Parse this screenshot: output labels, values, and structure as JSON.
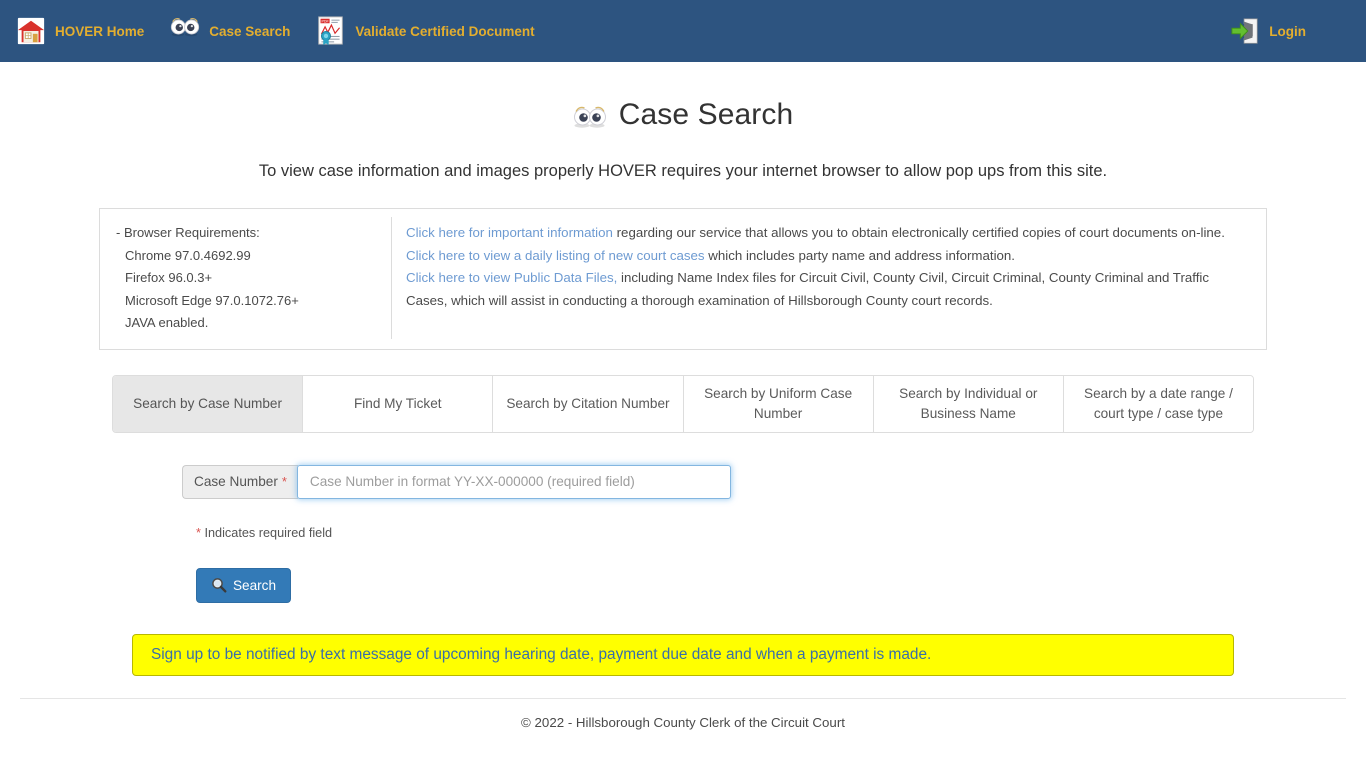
{
  "navbar": {
    "items": [
      {
        "label": "HOVER Home",
        "icon": "house-icon"
      },
      {
        "label": "Case Search",
        "icon": "eyes-icon"
      },
      {
        "label": "Validate Certified Document",
        "icon": "pdf-certificate-icon"
      }
    ],
    "login": {
      "label": "Login",
      "icon": "login-arrow-icon"
    },
    "background_color": "#2d5480",
    "link_color": "#e3ae2f"
  },
  "header": {
    "title": "Case Search",
    "title_icon": "eyes-icon",
    "popup_notice": "To view case information and images properly HOVER requires your internet browser to allow pop ups from this site."
  },
  "requirements": {
    "heading": "- Browser Requirements:",
    "items": [
      "Chrome 97.0.4692.99",
      "Firefox 96.0.3+",
      "Microsoft Edge 97.0.1072.76+",
      "JAVA enabled."
    ],
    "notes": [
      {
        "link": "Click here for important information",
        "rest": " regarding our service that allows you to obtain electronically certified copies of court documents on-line."
      },
      {
        "link": "Click here to view a daily listing of new court cases",
        "rest": " which includes party name and address information."
      },
      {
        "link": "Click here to view Public Data Files,",
        "rest": " including Name Index files for Circuit Civil, County Civil, Circuit Criminal, County Criminal and Traffic Cases, which will assist in conducting a thorough examination of Hillsborough County court records."
      }
    ],
    "link_color": "#6e9bd2"
  },
  "tabs": {
    "active_index": 0,
    "items": [
      "Search by Case Number",
      "Find My Ticket",
      "Search by Citation Number",
      "Search by Uniform Case Number",
      "Search by Individual or Business Name",
      "Search by a date range / court type / case type"
    ]
  },
  "form": {
    "case_number_label": "Case Number",
    "required_marker": "*",
    "case_number_value": "",
    "case_number_placeholder": "Case Number in format YY-XX-000000 (required field)",
    "required_note_star": "*",
    "required_note_text": " Indicates required field",
    "search_button_label": "Search",
    "search_button_icon": "magnifying-glass-icon",
    "search_button_color": "#337ab7"
  },
  "alert": {
    "text": "Sign up to be notified by text message of upcoming hearing date, payment due date and when a payment is made.",
    "background_color": "#ffff00",
    "text_color": "#3a6fa8"
  },
  "footer": {
    "text": "© 2022 - Hillsborough County Clerk of the Circuit Court"
  }
}
